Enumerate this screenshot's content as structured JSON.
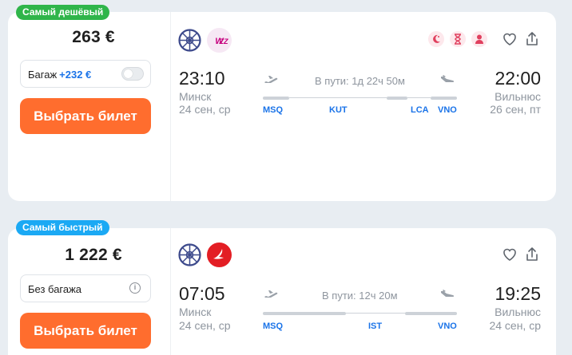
{
  "colors": {
    "accent_orange": "#ff6d2e",
    "badge_green": "#2fb54a",
    "badge_blue": "#1ba9f4",
    "link_blue": "#1a73e8",
    "muted_text": "#8e959e"
  },
  "offers": [
    {
      "badge": "Самый дешёвый",
      "price": "263 €",
      "baggage": {
        "label": "Багаж",
        "extra_price": "+232 €",
        "control": "toggle-off"
      },
      "buy_label": "Выбрать билет",
      "airlines": [
        "belavia-style-wheel-logo",
        "wizz-air-logo"
      ],
      "features": [
        "night-flight-icon",
        "long-layover-icon",
        "self-transfer-icon"
      ],
      "actions": [
        "heart-icon",
        "share-icon"
      ],
      "departure": {
        "time": "23:10",
        "city": "Минск",
        "date": "24 сен, ср"
      },
      "arrival": {
        "time": "22:00",
        "city": "Вильнюс",
        "date": "26 сен, пт"
      },
      "duration": "В пути: 1д 22ч 50м",
      "stops": [
        "MSQ",
        "KUT",
        "LCA",
        "VNO"
      ]
    },
    {
      "badge": "Самый быстрый",
      "price": "1 222 €",
      "baggage": {
        "label": "Без багажа",
        "control": "info"
      },
      "buy_label": "Выбрать билет",
      "airlines": [
        "belavia-style-wheel-logo",
        "turkish-airlines-logo"
      ],
      "actions": [
        "heart-icon",
        "share-icon"
      ],
      "departure": {
        "time": "07:05",
        "city": "Минск",
        "date": "24 сен, ср"
      },
      "arrival": {
        "time": "19:25",
        "city": "Вильнюс",
        "date": "24 сен, ср"
      },
      "duration": "В пути: 12ч 20м",
      "stops": [
        "MSQ",
        "IST",
        "VNO"
      ]
    }
  ]
}
